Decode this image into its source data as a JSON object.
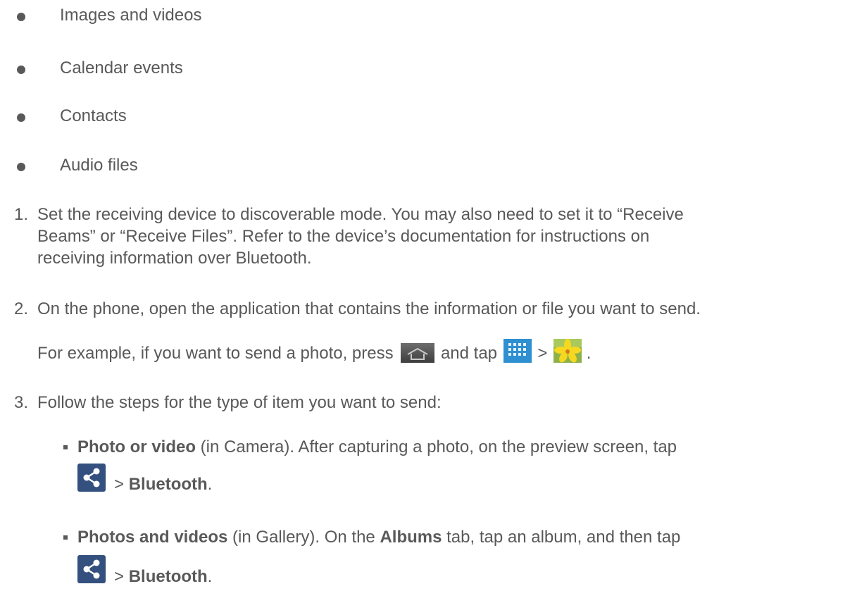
{
  "bullets": [
    "Images and videos",
    "Calendar events",
    "Contacts",
    "Audio files"
  ],
  "steps": [
    {
      "number": "1.",
      "lines": [
        "Set the receiving device to discoverable mode. You may also need to set it to “Receive",
        "Beams” or “Receive Files”. Refer to the device’s documentation for instructions on",
        "receiving information over Bluetooth."
      ]
    },
    {
      "number": "2.",
      "text": "On the phone, open the application that contains the information or file you want to send.",
      "example_prefix": "For example, if you want to send a photo, press",
      "example_and_tap": "and tap",
      "example_gt": ">",
      "example_period": "."
    },
    {
      "number": "3.",
      "text": "Follow the steps for the type of item you want to send:"
    }
  ],
  "sub_items": [
    {
      "bold": "Photo or video",
      "rest": " (in Camera). After capturing a photo, on the preview screen, tap",
      "gt": ">",
      "action": "Bluetooth",
      "period": "."
    },
    {
      "bold": "Photos and videos",
      "mid1": " (in Gallery). On the ",
      "bold2": "Albums",
      "mid2": " tab, tap an album, and then tap",
      "gt": ">",
      "action": "Bluetooth",
      "period": "."
    }
  ],
  "icons": {
    "home": "home-key-icon",
    "apps": "apps-grid-icon",
    "gallery": "gallery-flower-icon",
    "share": "share-icon"
  }
}
